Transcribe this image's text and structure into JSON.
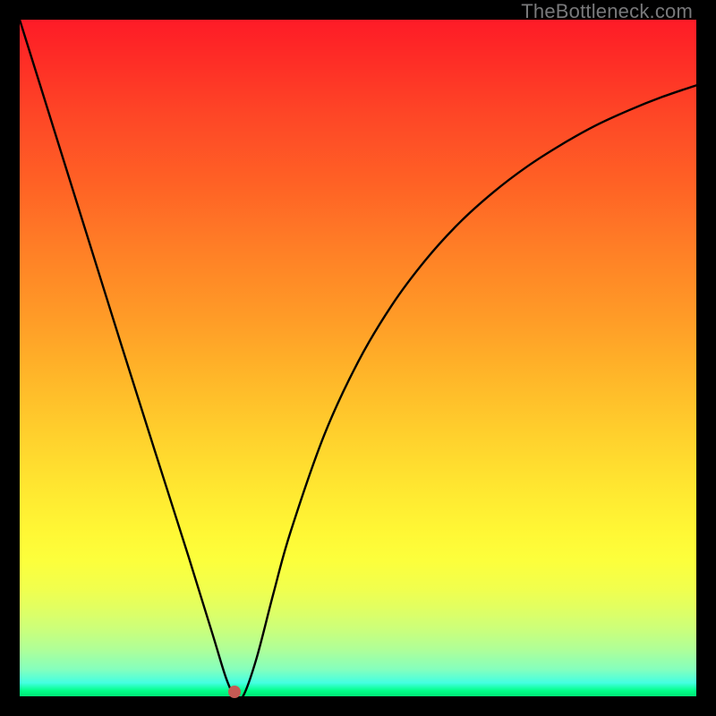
{
  "watermark": "TheBottleneck.com",
  "marker": {
    "x_frac": 0.318,
    "y_frac": 0.993
  },
  "chart_data": {
    "type": "line",
    "title": "",
    "xlabel": "",
    "ylabel": "",
    "xlim": [
      0,
      1
    ],
    "ylim": [
      0,
      1
    ],
    "series": [
      {
        "name": "curve",
        "x": [
          0.0,
          0.05,
          0.1,
          0.15,
          0.2,
          0.25,
          0.285,
          0.305,
          0.318,
          0.33,
          0.35,
          0.375,
          0.4,
          0.45,
          0.5,
          0.55,
          0.6,
          0.65,
          0.7,
          0.75,
          0.8,
          0.85,
          0.9,
          0.95,
          1.0
        ],
        "y": [
          1.0,
          0.84,
          0.68,
          0.52,
          0.362,
          0.205,
          0.092,
          0.027,
          0.0,
          0.0,
          0.056,
          0.152,
          0.242,
          0.386,
          0.494,
          0.578,
          0.645,
          0.7,
          0.745,
          0.783,
          0.815,
          0.843,
          0.866,
          0.886,
          0.903
        ]
      }
    ],
    "marker": {
      "x": 0.318,
      "y": 0.007
    }
  }
}
